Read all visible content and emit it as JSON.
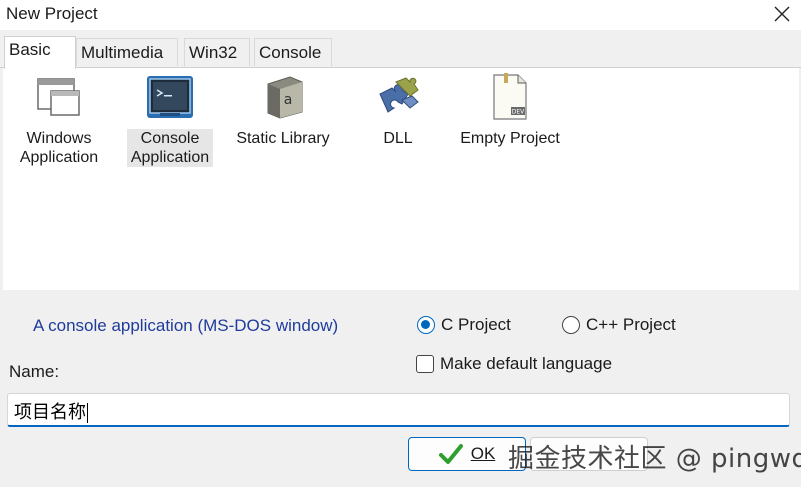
{
  "window": {
    "title": "New Project"
  },
  "tabs": [
    {
      "label": "Basic",
      "active": true
    },
    {
      "label": "Multimedia",
      "active": false
    },
    {
      "label": "Win32",
      "active": false
    },
    {
      "label": "Console",
      "active": false
    }
  ],
  "templates": [
    {
      "label": "Windows\nApplication",
      "icon": "windows-app-icon",
      "selected": false
    },
    {
      "label": "Console\nApplication",
      "icon": "console-app-icon",
      "selected": true
    },
    {
      "label": "Static Library",
      "icon": "static-library-icon",
      "selected": false
    },
    {
      "label": "DLL",
      "icon": "dll-puzzle-icon",
      "selected": false
    },
    {
      "label": "Empty Project",
      "icon": "empty-project-icon",
      "selected": false
    }
  ],
  "description": "A console application (MS-DOS window)",
  "language": {
    "options": [
      {
        "label": "C Project",
        "checked": true
      },
      {
        "label": "C++ Project",
        "checked": false
      }
    ],
    "make_default_label": "Make default language",
    "make_default_checked": false
  },
  "name": {
    "label": "Name:",
    "value": "项目名称"
  },
  "buttons": {
    "ok_label": "OK"
  },
  "watermark": "掘金技术社区 @ pingwd",
  "colors": {
    "accent": "#0067c0",
    "description_text": "#1f3c9c",
    "check_green": "#2e9e2e"
  }
}
